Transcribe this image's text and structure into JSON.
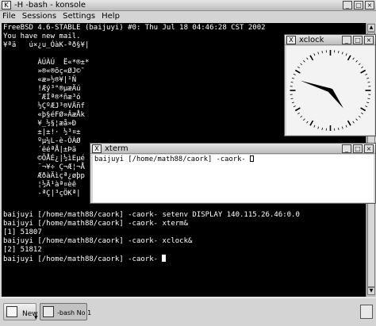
{
  "konsole": {
    "title": "-H -bash - konsole",
    "menu": [
      "File",
      "Sessions",
      "Settings",
      "Help"
    ],
    "terminal_lines": [
      "FreeBSD 4.6-STABLE (baijuyi) #0: Thu Jul 18 04:46:28 CST 2002",
      "You have new mail.",
      "¥ªä   ú×¿u_ÓàK-ªð§¥|",
      "",
      "        ÀÚÀÚ  Ë«*®±*",
      "        »®«®õç«ØJ©¯",
      "        «æ»½®¥|¹Ñ",
      "        !Æý³°®µæÄú",
      "        ¨ÆÍª®*ñæ³ó",
      "        ½ÇºÆJ³®VÄñf",
      "        «þ§éFØ»ÂæÅk",
      "        ¥_½§¦æå»Ð",
      "        ±|±!· ½³¤±",
      "        ºµ¼L-è-ÖÀØ",
      "        ´êéªÅ|±Þä",
      "        ©ÕÅÉ¿|½ìEµé",
      "        ¨¬¥÷ Ç¬Æ¦¬Å",
      "        ÆðàÄìçª¿øþp",
      "        ¦½Ä¹àª¤èê",
      "        -ªÇ|³çÖKª|",
      "",
      "",
      "",
      "baijuyi [/home/math88/caork] -caork- setenv DISPLAY 140.115.26.46:0.0",
      "baijuyi [/home/math88/caork] -caork- xterm&",
      "[1] 51807",
      "baijuyi [/home/math88/caork] -caork- xclock&",
      "[2] 51812",
      "baijuyi [/home/math88/caork] -caork- "
    ],
    "taskbar": {
      "new_label": "New",
      "session_label": "-bash No 1"
    }
  },
  "xterm": {
    "title": "xterm",
    "line": "baijuyi [/home/math88/caork] -caork- "
  },
  "xclock": {
    "title": "xclock",
    "time_shown": "04:48:00"
  },
  "colors": {
    "terminal_bg": "#000000",
    "terminal_fg": "#ffffff",
    "chrome": "#d4d4d4"
  },
  "icons": [
    "window-menu-icon",
    "minimize-icon",
    "maximize-icon",
    "close-icon",
    "new-session-icon",
    "terminal-session-icon",
    "taskbar-menu-icon"
  ]
}
